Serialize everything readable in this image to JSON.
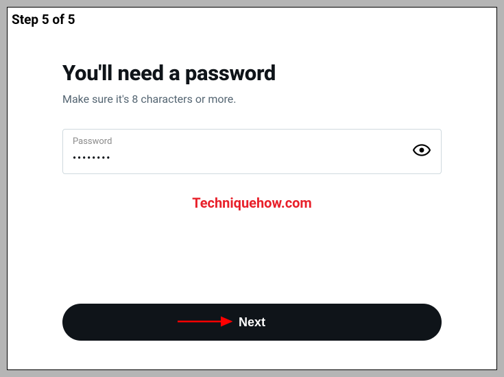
{
  "step": {
    "label": "Step 5 of 5"
  },
  "heading": "You'll need a password",
  "subheading": "Make sure it's 8 characters or more.",
  "password": {
    "label": "Password",
    "masked_value": "••••••••"
  },
  "next_button": {
    "label": "Next"
  },
  "watermark": "Techniquehow.com",
  "annotation": {
    "arrow_color": "#ff0000"
  }
}
